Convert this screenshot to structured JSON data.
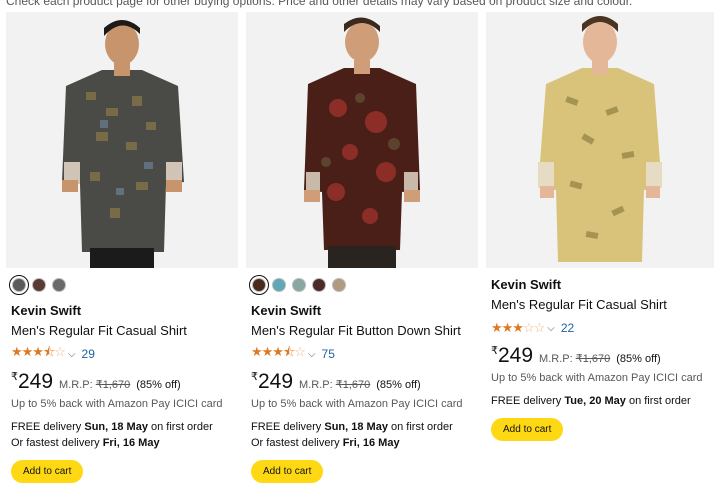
{
  "notice": "Check each product page for other buying options. Price and other details may vary based on product size and colour.",
  "products": [
    {
      "swatches": [
        "#5a5a5a",
        "#5a3a34",
        "#6a6a6a"
      ],
      "brand": "Kevin Swift",
      "title": "Men's Regular Fit Casual Shirt",
      "rating": 3.5,
      "rating_count": "29",
      "currency": "₹",
      "price": "249",
      "mrp_label": "M.R.P:",
      "mrp": "₹1,670",
      "discount": "(85% off)",
      "cashback": "Up to 5% back with Amazon Pay ICICI card",
      "delivery_prefix": "FREE delivery ",
      "delivery_date": "Sun, 18 May",
      "delivery_suffix": " on first order",
      "fastest_prefix": "Or fastest delivery ",
      "fastest_date": "Fri, 16 May",
      "button": "Add to cart"
    },
    {
      "swatches": [
        "#4b2a1c",
        "#5fa8b6",
        "#8aa6a0",
        "#4b2b27",
        "#b09a80"
      ],
      "brand": "Kevin Swift",
      "title": "Men's Regular Fit Button Down Shirt",
      "rating": 3.5,
      "rating_count": "75",
      "currency": "₹",
      "price": "249",
      "mrp_label": "M.R.P:",
      "mrp": "₹1,670",
      "discount": "(85% off)",
      "cashback": "Up to 5% back with Amazon Pay ICICI card",
      "delivery_prefix": "FREE delivery ",
      "delivery_date": "Sun, 18 May",
      "delivery_suffix": " on first order",
      "fastest_prefix": "Or fastest delivery ",
      "fastest_date": "Fri, 16 May",
      "button": "Add to cart"
    },
    {
      "swatches": [],
      "brand": "Kevin Swift",
      "title": "Men's Regular Fit Casual Shirt",
      "rating": 3,
      "rating_count": "22",
      "currency": "₹",
      "price": "249",
      "mrp_label": "M.R.P:",
      "mrp": "₹1,670",
      "discount": "(85% off)",
      "cashback": "Up to 5% back with Amazon Pay ICICI card",
      "delivery_prefix": "FREE delivery ",
      "delivery_date": "Tue, 20 May",
      "delivery_suffix": " on first order",
      "button": "Add to cart"
    }
  ]
}
